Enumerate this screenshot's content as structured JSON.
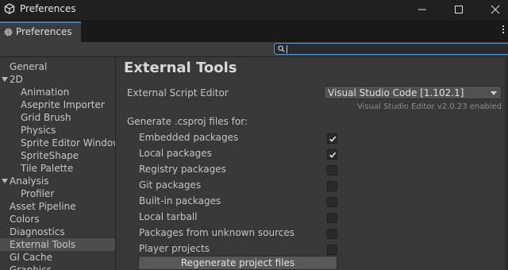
{
  "window": {
    "title": "Preferences",
    "tab_label": "Preferences"
  },
  "search": {
    "value": "",
    "placeholder": ""
  },
  "sidebar": {
    "items": [
      {
        "label": "General",
        "level": 0,
        "expanded": null,
        "selected": false
      },
      {
        "label": "2D",
        "level": 0,
        "expanded": true,
        "selected": false
      },
      {
        "label": "Animation",
        "level": 1,
        "expanded": null,
        "selected": false
      },
      {
        "label": "Aseprite Importer",
        "level": 1,
        "expanded": null,
        "selected": false
      },
      {
        "label": "Grid Brush",
        "level": 1,
        "expanded": null,
        "selected": false
      },
      {
        "label": "Physics",
        "level": 1,
        "expanded": null,
        "selected": false
      },
      {
        "label": "Sprite Editor Window",
        "level": 1,
        "expanded": null,
        "selected": false
      },
      {
        "label": "SpriteShape",
        "level": 1,
        "expanded": null,
        "selected": false
      },
      {
        "label": "Tile Palette",
        "level": 1,
        "expanded": null,
        "selected": false
      },
      {
        "label": "Analysis",
        "level": 0,
        "expanded": true,
        "selected": false
      },
      {
        "label": "Profiler",
        "level": 1,
        "expanded": null,
        "selected": false
      },
      {
        "label": "Asset Pipeline",
        "level": 0,
        "expanded": null,
        "selected": false
      },
      {
        "label": "Colors",
        "level": 0,
        "expanded": null,
        "selected": false
      },
      {
        "label": "Diagnostics",
        "level": 0,
        "expanded": null,
        "selected": false
      },
      {
        "label": "External Tools",
        "level": 0,
        "expanded": null,
        "selected": true
      },
      {
        "label": "GI Cache",
        "level": 0,
        "expanded": null,
        "selected": false
      },
      {
        "label": "Graphics",
        "level": 0,
        "expanded": null,
        "selected": false
      }
    ]
  },
  "main": {
    "heading": "External Tools",
    "script_editor_label": "External Script Editor",
    "script_editor_value": "Visual Studio Code [1.102.1]",
    "editor_note": "Visual Studio Editor v2.0.23 enabled",
    "generate_label": "Generate .csproj files for:",
    "options": [
      {
        "label": "Embedded packages",
        "checked": true
      },
      {
        "label": "Local packages",
        "checked": true
      },
      {
        "label": "Registry packages",
        "checked": false
      },
      {
        "label": "Git packages",
        "checked": false
      },
      {
        "label": "Built-in packages",
        "checked": false
      },
      {
        "label": "Local tarball",
        "checked": false
      },
      {
        "label": "Packages from unknown sources",
        "checked": false
      },
      {
        "label": "Player projects",
        "checked": false
      }
    ],
    "regenerate_label": "Regenerate project files"
  },
  "colors": {
    "accent": "#3a79bb",
    "selection": "#4d4d4d",
    "panel": "#383838"
  }
}
